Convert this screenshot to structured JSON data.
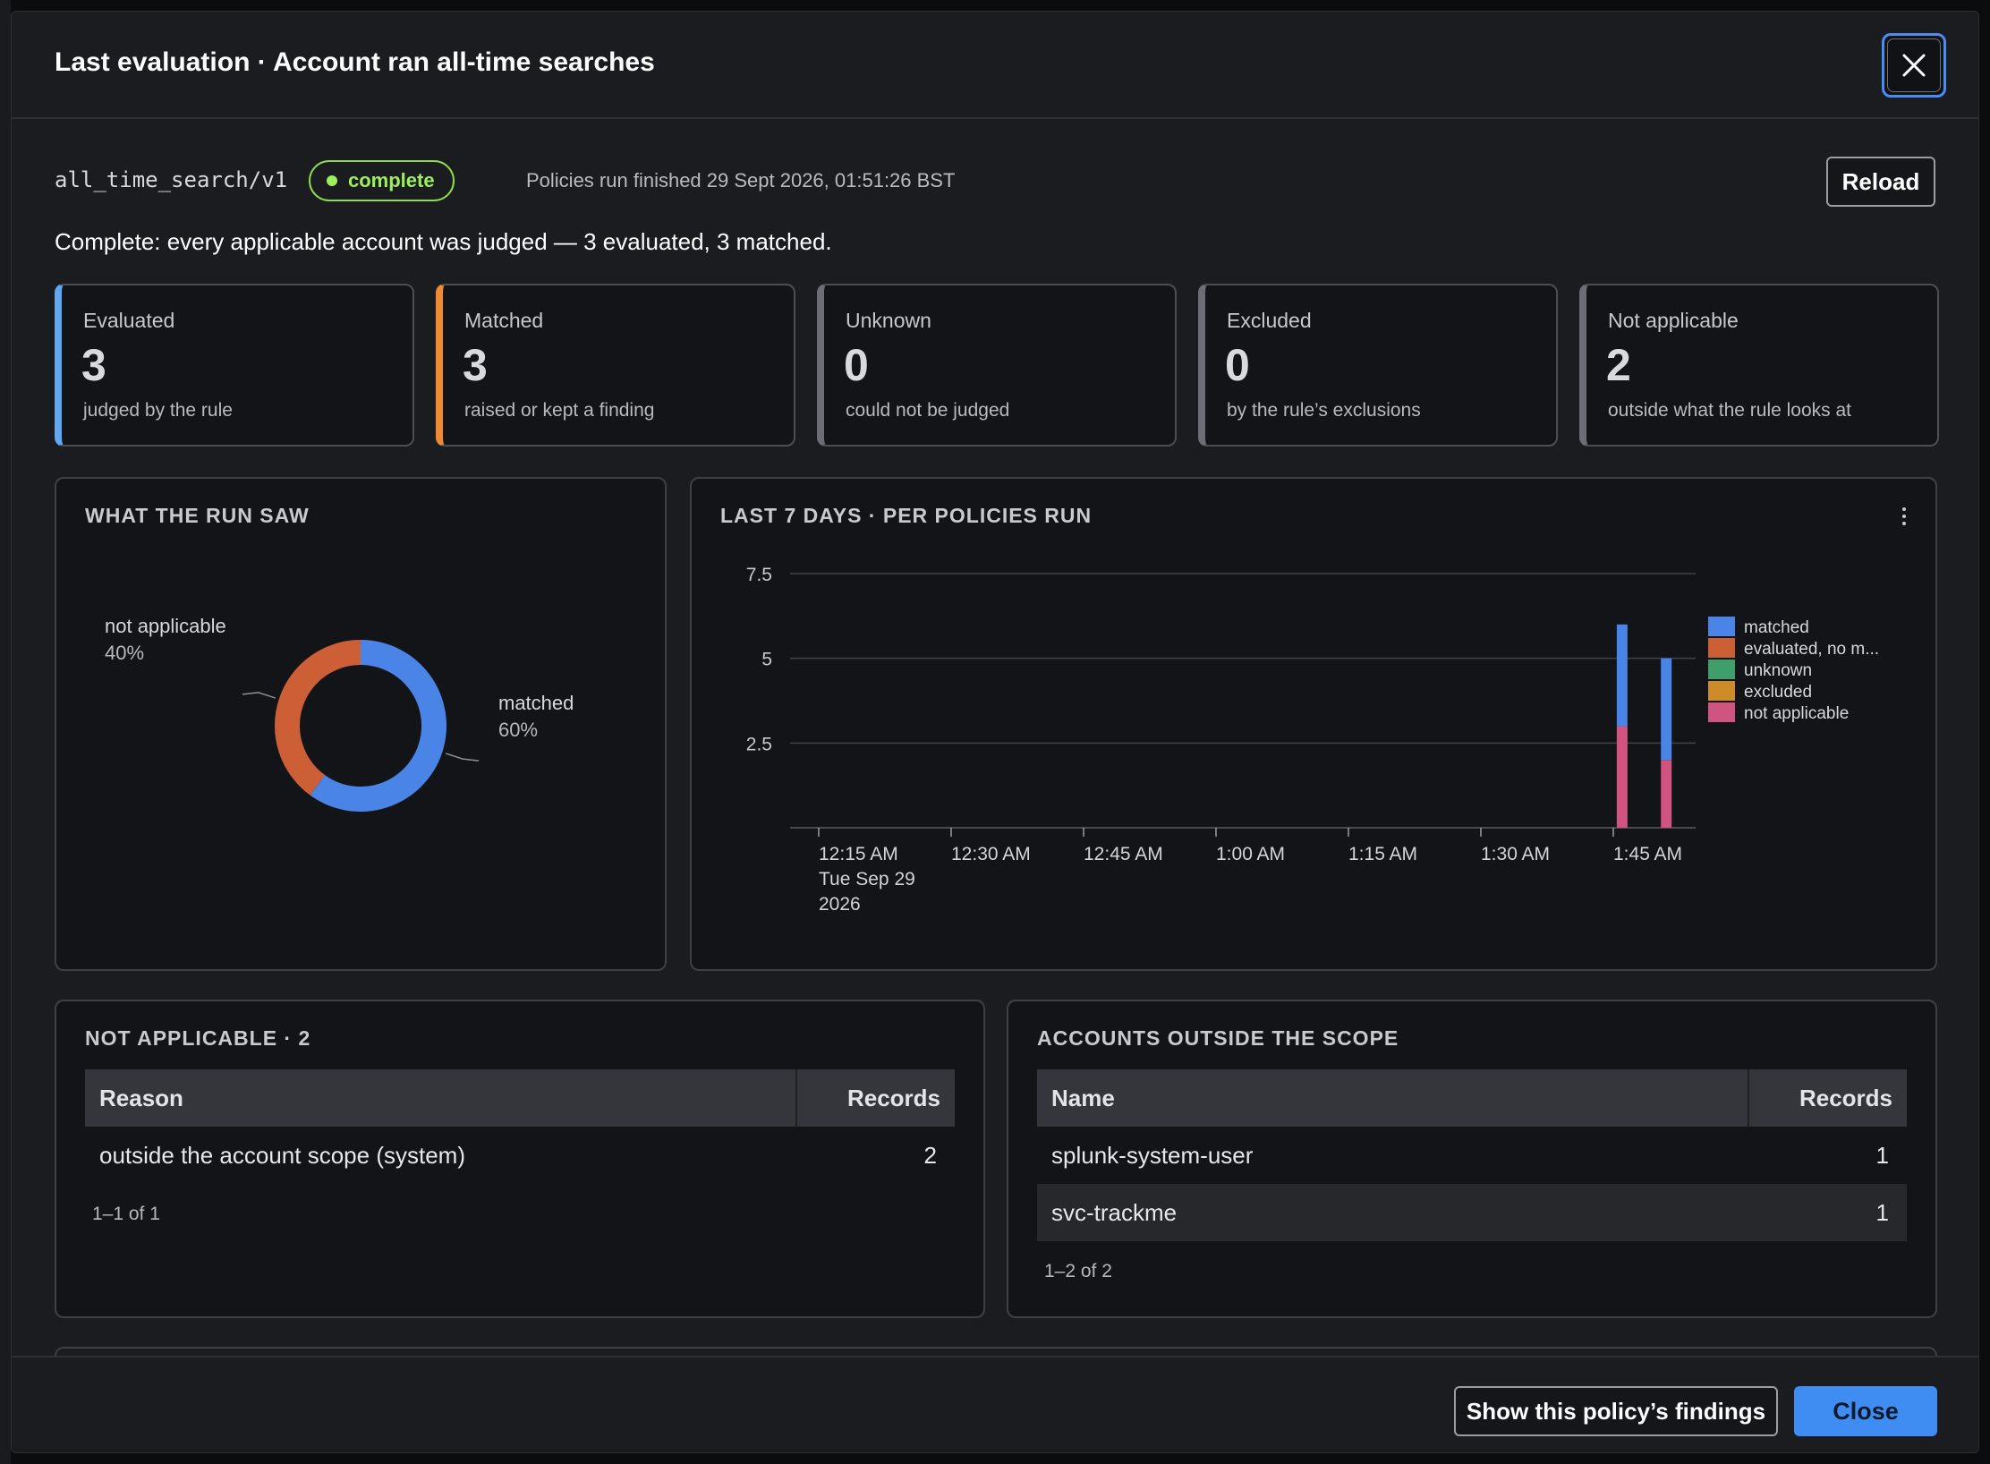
{
  "header": {
    "title": "Last evaluation · Account ran all-time searches",
    "close_icon": "close-icon"
  },
  "meta": {
    "policy_id": "all_time_search/v1",
    "status": "complete",
    "status_color": "#9ef05a",
    "run_finished": "Policies run finished 29 Sept 2026, 01:51:26 BST",
    "reload_label": "Reload"
  },
  "summary": "Complete: every applicable account was judged — 3 evaluated, 3 matched.",
  "stats": [
    {
      "label": "Evaluated",
      "value": "3",
      "sub": "judged by the rule",
      "accent": "#5ea8f2"
    },
    {
      "label": "Matched",
      "value": "3",
      "sub": "raised or kept a finding",
      "accent": "#f08a2e"
    },
    {
      "label": "Unknown",
      "value": "0",
      "sub": "could not be judged",
      "accent": "#6b6e75"
    },
    {
      "label": "Excluded",
      "value": "0",
      "sub": "by the rule’s exclusions",
      "accent": "#6b6e75"
    },
    {
      "label": "Not applicable",
      "value": "2",
      "sub": "outside what the rule looks at",
      "accent": "#6b6e75"
    }
  ],
  "donut_panel": {
    "title": "WHAT THE RUN SAW"
  },
  "trend_panel": {
    "title": "LAST 7 DAYS · PER POLICIES RUN",
    "menu_icon": "more-vertical-icon"
  },
  "chart_data": [
    {
      "type": "pie",
      "style": "donut",
      "labels": [
        "matched",
        "not applicable"
      ],
      "values": [
        60,
        40
      ],
      "display": [
        "60%",
        "40%"
      ],
      "colors": [
        "#4a84e6",
        "#cd5f36"
      ]
    },
    {
      "type": "bar",
      "stacked": true,
      "x_tick_labels": [
        "12:15 AM",
        "12:30 AM",
        "12:45 AM",
        "1:00 AM",
        "1:15 AM",
        "1:30 AM",
        "1:45 AM"
      ],
      "x_first_tick_sublabel": [
        "Tue Sep 29",
        "2026"
      ],
      "y_ticks": [
        "2.5",
        "5",
        "7.5"
      ],
      "y_tick_values": [
        2.5,
        5,
        7.5
      ],
      "ylim": [
        0,
        7.5
      ],
      "grid": true,
      "legend_position": "right",
      "bars": [
        {
          "time": "1:46 AM",
          "segments": {
            "matched": 3,
            "evaluated, no m...": 0,
            "unknown": 0,
            "excluded": 0,
            "not applicable": 3
          }
        },
        {
          "time": "1:51 AM",
          "segments": {
            "matched": 3,
            "evaluated, no m...": 0,
            "unknown": 0,
            "excluded": 0,
            "not applicable": 2
          }
        }
      ],
      "series": [
        {
          "name": "matched",
          "color": "#4a84e6"
        },
        {
          "name": "evaluated, no m...",
          "color": "#cd5f36"
        },
        {
          "name": "unknown",
          "color": "#3e9e6c"
        },
        {
          "name": "excluded",
          "color": "#cf8b2a"
        },
        {
          "name": "not applicable",
          "color": "#cf5480"
        }
      ]
    }
  ],
  "not_applicable": {
    "title": "NOT APPLICABLE · 2",
    "columns": [
      "Reason",
      "Records"
    ],
    "rows": [
      {
        "reason": "outside the account scope (system)",
        "records": "2"
      }
    ],
    "pager": "1–1 of 1"
  },
  "outside_scope": {
    "title": "ACCOUNTS OUTSIDE THE SCOPE",
    "columns": [
      "Name",
      "Records"
    ],
    "rows": [
      {
        "name": "splunk-system-user",
        "records": "1"
      },
      {
        "name": "svc-trackme",
        "records": "1"
      }
    ],
    "pager": "1–2 of 2"
  },
  "footer": {
    "findings_label": "Show this policy’s findings",
    "close_label": "Close"
  }
}
